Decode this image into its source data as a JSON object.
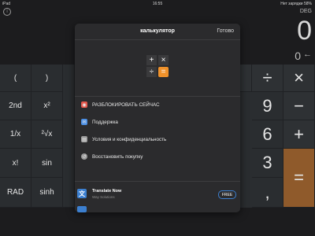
{
  "status": {
    "device": "iPad",
    "time": "16:55",
    "battery": "Нет зарядки 58%"
  },
  "calc": {
    "mode": "DEG",
    "display": "0",
    "secondary": "0",
    "backspace": "←",
    "keys": {
      "open_paren": "(",
      "close_paren": ")",
      "second": "2nd",
      "x_squared": "x²",
      "reciprocal": "1/x",
      "sqrt2": "²√x",
      "factorial": "x!",
      "sin": "sin",
      "rad": "RAD",
      "sinh": "sinh",
      "divide": "÷",
      "multiply": "×",
      "nine": "9",
      "minus": "−",
      "six": "6",
      "plus": "+",
      "three": "3",
      "comma": ",",
      "equals": "="
    },
    "colors": {
      "accent": "#8f5a2b",
      "background": "#1c1c1e",
      "keypad": "#2a2d30"
    }
  },
  "sheet": {
    "title": "калькулятор",
    "done": "Готово",
    "icon": {
      "plus": "+",
      "times": "×",
      "divide": "÷",
      "equals": "="
    },
    "items": [
      {
        "label": "РАЗБЛОКИРОВАТЬ СЕЙЧАС",
        "icon": "lock-icon",
        "color": "#e4574c"
      },
      {
        "label": "Поддержка",
        "icon": "mail-icon",
        "color": "#4c8fe4"
      },
      {
        "label": "Условия и конфиденциальность",
        "icon": "document-icon",
        "color": "#9a9a9a"
      },
      {
        "label": "Восстановить покупку",
        "icon": "restore-icon",
        "color": "#9a9a9a"
      }
    ],
    "ad": {
      "name": "Translate Now",
      "subtitle": "Way Solutions",
      "button": "FREE"
    }
  }
}
